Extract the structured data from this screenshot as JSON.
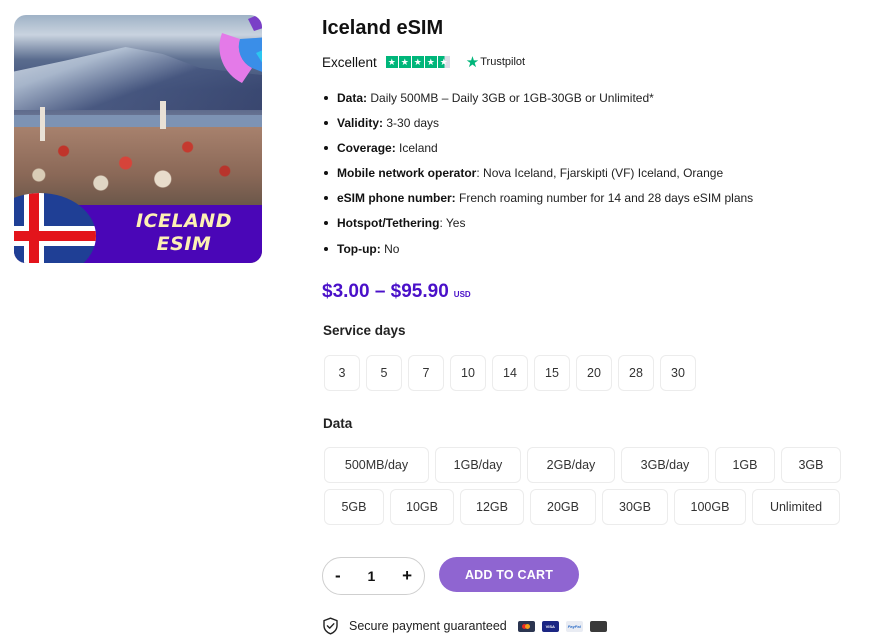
{
  "product": {
    "image_alt": "Iceland eSIM product image",
    "banner_line1": "ICELAND",
    "banner_line2": "ESIM",
    "title": "Iceland eSIM"
  },
  "rating": {
    "label": "Excellent",
    "stars": 4.5,
    "star_glyph": "★",
    "provider": "Trustpilot",
    "provider_icon": "trustpilot-star-icon",
    "accent_color": "#00b67a"
  },
  "features": [
    {
      "label": "Data:",
      "value": " Daily 500MB – Daily 3GB or 1GB-30GB or Unlimited*"
    },
    {
      "label": "Validity:",
      "value": " 3-30 days"
    },
    {
      "label": "Coverage:",
      "value": " Iceland"
    },
    {
      "label": "Mobile network operator",
      "value": ": Nova Iceland, Fjarskipti (VF) Iceland, Orange"
    },
    {
      "label": "eSIM phone number:",
      "value": " French roaming number for 14 and 28 days eSIM plans"
    },
    {
      "label": "Hotspot/Tethering",
      "value": ": Yes"
    },
    {
      "label": "Top-up:",
      "value": " No"
    }
  ],
  "price": {
    "range": "$3.00 – $95.90",
    "currency": "USD",
    "color": "#4a10c9"
  },
  "service_days": {
    "label": "Service days",
    "options": [
      "3",
      "5",
      "7",
      "10",
      "14",
      "15",
      "20",
      "28",
      "30"
    ]
  },
  "data_options": {
    "label": "Data",
    "row1": [
      "500MB/day",
      "1GB/day",
      "2GB/day",
      "3GB/day",
      "1GB",
      "3GB"
    ],
    "row2": [
      "5GB",
      "10GB",
      "12GB",
      "20GB",
      "30GB",
      "100GB",
      "Unlimited"
    ]
  },
  "cart": {
    "decrement": "-",
    "quantity": "1",
    "increment": "+",
    "add_label": "ADD TO CART",
    "button_color": "#8f65d1"
  },
  "secure": {
    "text": "Secure payment guaranteed",
    "icon": "shield-check-icon",
    "payment_methods": [
      "Mastercard",
      "Visa",
      "PayPal",
      "Apple Pay"
    ],
    "visa_text": "VISA",
    "paypal_text": "PayPal",
    "apple_glyph": ""
  }
}
